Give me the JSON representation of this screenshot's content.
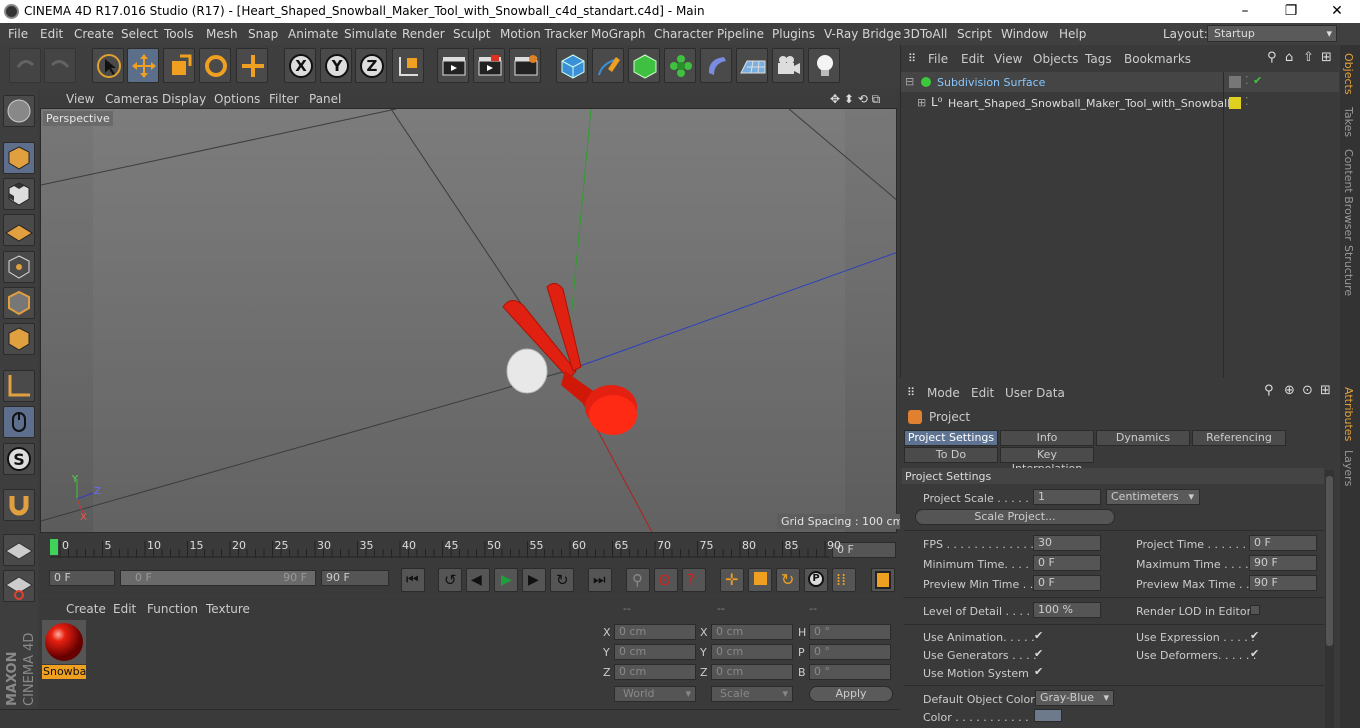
{
  "window": {
    "title": "CINEMA 4D R17.016 Studio (R17) - [Heart_Shaped_Snowball_Maker_Tool_with_Snowball_c4d_standart.c4d] - Main",
    "minimize": "–",
    "maximize": "❐",
    "close": "✕"
  },
  "menubar": {
    "items": [
      "File",
      "Edit",
      "Create",
      "Select",
      "Tools",
      "Mesh",
      "Snap",
      "Animate",
      "Simulate",
      "Render",
      "Sculpt",
      "Motion Tracker",
      "MoGraph",
      "Character",
      "Pipeline",
      "Plugins",
      "V-Ray Bridge",
      "3DToAll",
      "Script",
      "Window",
      "Help"
    ],
    "layout_label": "Layout:",
    "layout_value": "Startup"
  },
  "toolbar": {
    "axis_x": "X",
    "axis_y": "Y",
    "axis_z": "Z"
  },
  "viewport": {
    "menu": [
      "View",
      "Cameras",
      "Display",
      "Options",
      "Filter",
      "Panel"
    ],
    "label": "Perspective",
    "grid_spacing": "Grid Spacing : 100 cm",
    "axis_x": "X",
    "axis_y": "Y",
    "axis_z": "Z"
  },
  "timeline": {
    "ticks": [
      "0",
      "5",
      "10",
      "15",
      "20",
      "25",
      "30",
      "35",
      "40",
      "45",
      "50",
      "55",
      "60",
      "65",
      "70",
      "75",
      "80",
      "85",
      "90"
    ],
    "current_frame": "0 F",
    "start_field": "0 F",
    "range_start": "0 F",
    "range_end": "90 F",
    "end_field": "90 F"
  },
  "material_manager": {
    "menu": [
      "Create",
      "Edit",
      "Function",
      "Texture"
    ],
    "material_name": "Snowba"
  },
  "coordinates": {
    "header": [
      "--",
      "--",
      "--"
    ],
    "rows": [
      {
        "a": "X",
        "av": "0 cm",
        "b": "X",
        "bv": "0 cm",
        "c": "H",
        "cv": "0 °"
      },
      {
        "a": "Y",
        "av": "0 cm",
        "b": "Y",
        "bv": "0 cm",
        "c": "P",
        "cv": "0 °"
      },
      {
        "a": "Z",
        "av": "0 cm",
        "b": "Z",
        "bv": "0 cm",
        "c": "B",
        "cv": "0 °"
      }
    ],
    "world": "World",
    "scale": "Scale",
    "apply": "Apply"
  },
  "object_manager": {
    "menu": [
      "File",
      "Edit",
      "View",
      "Objects",
      "Tags",
      "Bookmarks"
    ],
    "objects": [
      {
        "name": "Subdivision Surface"
      },
      {
        "name": "Heart_Shaped_Snowball_Maker_Tool_with_Snowball"
      }
    ]
  },
  "attribute_manager": {
    "menu": [
      "Mode",
      "Edit",
      "User Data"
    ],
    "object_label": "Project",
    "tabs_row1": [
      "Project Settings",
      "Info",
      "Dynamics",
      "Referencing"
    ],
    "tabs_row2": [
      "To Do",
      "Key Interpolation"
    ],
    "section": "Project Settings",
    "project_scale_label": "Project Scale . . . . . .",
    "project_scale_value": "1",
    "project_scale_unit": "Centimeters",
    "scale_project_button": "Scale Project...",
    "fps_label": "FPS . . . . . . . . . . . . . .",
    "fps_value": "30",
    "project_time_label": "Project Time . . . . . . .",
    "project_time_value": "0 F",
    "min_time_label": "Minimum Time. . . . .",
    "min_time_value": "0 F",
    "max_time_label": "Maximum Time . . . . .",
    "max_time_value": "90 F",
    "prev_min_label": "Preview Min Time . .",
    "prev_min_value": "0 F",
    "prev_max_label": "Preview Max Time . . .",
    "prev_max_value": "90 F",
    "lod_label": "Level of Detail . . . . .",
    "lod_value": "100 %",
    "render_lod_label": "Render LOD in Editor",
    "use_animation_label": "Use Animation. . . . .",
    "use_expression_label": "Use Expression . . . . .",
    "use_generators_label": "Use Generators . . . .",
    "use_deformers_label": "Use Deformers. . . . . .",
    "use_motion_label": "Use Motion System",
    "default_color_label": "Default Object Color",
    "default_color_value": "Gray-Blue",
    "color_label": "Color . . . . . . . . . . .",
    "check": "✔"
  },
  "side_tabs": [
    "Objects",
    "Takes",
    "Content Browser",
    "Structure",
    "Attributes",
    "Layers"
  ],
  "colors": {
    "accent_blue": "#5e7391",
    "tool_red": "#e02010",
    "snowball": "#e8e8e8"
  }
}
